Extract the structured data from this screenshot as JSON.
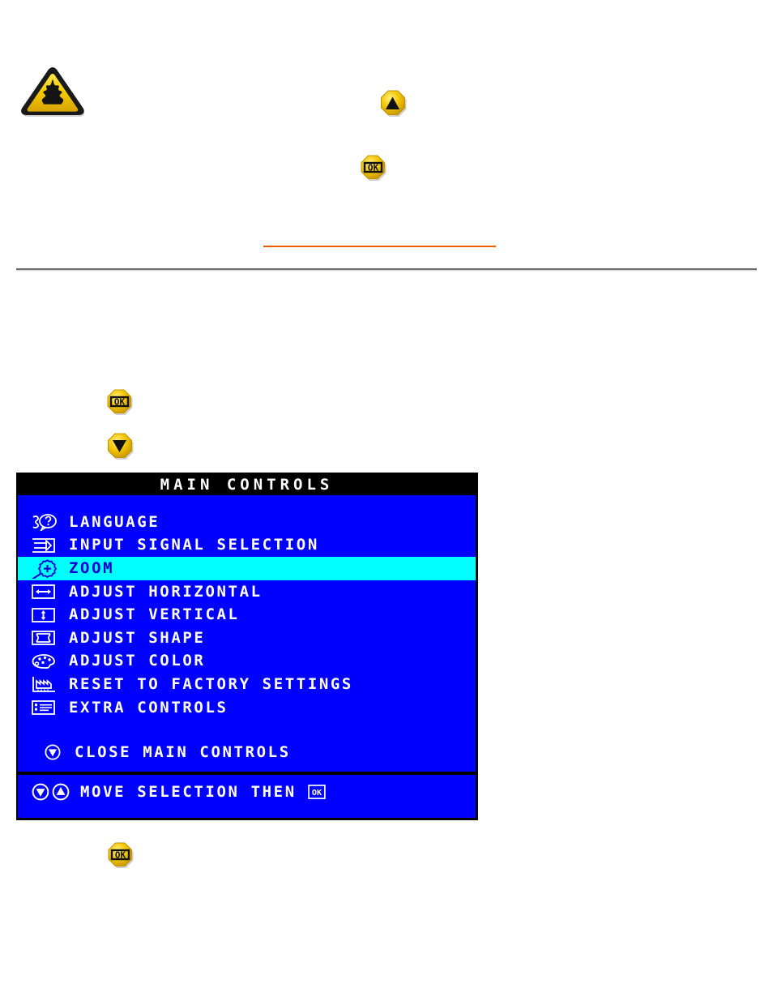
{
  "page": {
    "background_color": "#ffffff"
  },
  "rules": {
    "orange_color": "#ef5b09",
    "divider_color": "#6f6f74"
  },
  "buttons": {
    "warning_icon_name": "warning-triangle-icon",
    "up_label": "UP",
    "down_label": "DOWN",
    "ok_label": "OK"
  },
  "osd": {
    "title": "MAIN CONTROLS",
    "colors": {
      "background": "#0000ff",
      "titlebar": "#000000",
      "highlight": "#00ffff",
      "text": "#ffffff",
      "highlight_text": "#0000d0"
    },
    "items": [
      {
        "icon": "language-icon",
        "label": "LANGUAGE",
        "selected": false
      },
      {
        "icon": "input-signal-icon",
        "label": "INPUT SIGNAL SELECTION",
        "selected": false
      },
      {
        "icon": "zoom-icon",
        "label": "ZOOM",
        "selected": true
      },
      {
        "icon": "adjust-horizontal-icon",
        "label": "ADJUST HORIZONTAL",
        "selected": false
      },
      {
        "icon": "adjust-vertical-icon",
        "label": "ADJUST VERTICAL",
        "selected": false
      },
      {
        "icon": "adjust-shape-icon",
        "label": "ADJUST SHAPE",
        "selected": false
      },
      {
        "icon": "adjust-color-icon",
        "label": "ADJUST COLOR",
        "selected": false
      },
      {
        "icon": "factory-reset-icon",
        "label": "RESET TO FACTORY SETTINGS",
        "selected": false
      },
      {
        "icon": "extra-controls-icon",
        "label": "EXTRA CONTROLS",
        "selected": false
      }
    ],
    "close_row": {
      "icon": "down-arrow-icon",
      "label": "CLOSE MAIN CONTROLS"
    },
    "footer": {
      "down_icon": "down-arrow-icon",
      "up_icon": "up-arrow-icon",
      "label": "MOVE SELECTION THEN",
      "ok_icon": "ok-icon"
    }
  }
}
